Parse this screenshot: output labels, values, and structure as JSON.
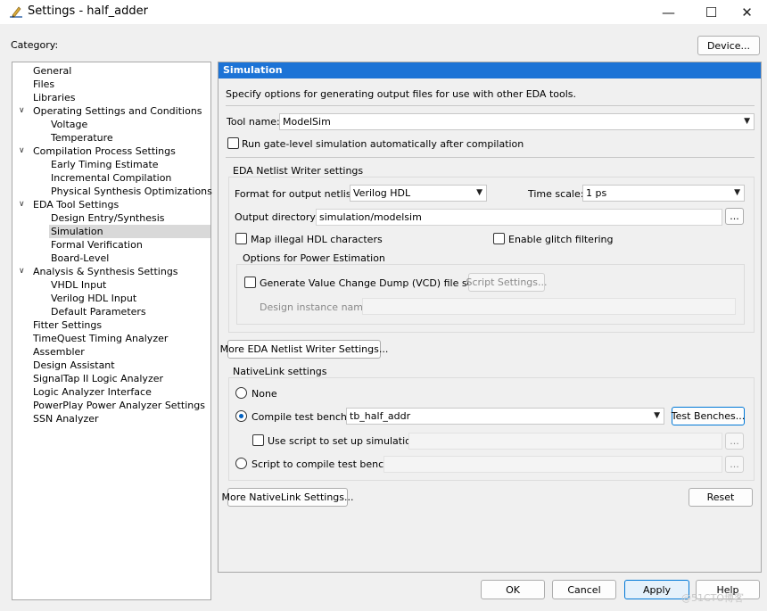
{
  "window": {
    "title": "Settings - half_adder",
    "minimize_glyph": "—",
    "maximize_glyph": "☐",
    "close_glyph": "✕",
    "icon": "pencil-icon"
  },
  "category_label": "Category:",
  "device_button": "Device...",
  "tree": [
    {
      "label": "General",
      "level": 0
    },
    {
      "label": "Files",
      "level": 0
    },
    {
      "label": "Libraries",
      "level": 0
    },
    {
      "label": "Operating Settings and Conditions",
      "level": 0,
      "expanded": true
    },
    {
      "label": "Voltage",
      "level": 1
    },
    {
      "label": "Temperature",
      "level": 1
    },
    {
      "label": "Compilation Process Settings",
      "level": 0,
      "expanded": true
    },
    {
      "label": "Early Timing Estimate",
      "level": 1
    },
    {
      "label": "Incremental Compilation",
      "level": 1
    },
    {
      "label": "Physical Synthesis Optimizations",
      "level": 1
    },
    {
      "label": "EDA Tool Settings",
      "level": 0,
      "expanded": true
    },
    {
      "label": "Design Entry/Synthesis",
      "level": 1
    },
    {
      "label": "Simulation",
      "level": 1,
      "selected": true
    },
    {
      "label": "Formal Verification",
      "level": 1
    },
    {
      "label": "Board-Level",
      "level": 1
    },
    {
      "label": "Analysis & Synthesis Settings",
      "level": 0,
      "expanded": true
    },
    {
      "label": "VHDL Input",
      "level": 1
    },
    {
      "label": "Verilog HDL Input",
      "level": 1
    },
    {
      "label": "Default Parameters",
      "level": 1
    },
    {
      "label": "Fitter Settings",
      "level": 0
    },
    {
      "label": "TimeQuest Timing Analyzer",
      "level": 0
    },
    {
      "label": "Assembler",
      "level": 0
    },
    {
      "label": "Design Assistant",
      "level": 0
    },
    {
      "label": "SignalTap II Logic Analyzer",
      "level": 0
    },
    {
      "label": "Logic Analyzer Interface",
      "level": 0
    },
    {
      "label": "PowerPlay Power Analyzer Settings",
      "level": 0
    },
    {
      "label": "SSN Analyzer",
      "level": 0
    }
  ],
  "sim": {
    "header": "Simulation",
    "description": "Specify options for generating output files for use with other EDA tools.",
    "tool_name_label": "Tool name:",
    "tool_name_value": "ModelSim",
    "run_gate_level": "Run gate-level simulation automatically after compilation",
    "netlist_group": "EDA Netlist Writer settings",
    "format_label": "Format for output netlist:",
    "format_value": "Verilog HDL",
    "timescale_label": "Time scale:",
    "timescale_value": "1 ps",
    "output_dir_label": "Output directory:",
    "output_dir_value": "simulation/modelsim",
    "browse": "...",
    "map_illegal": "Map illegal HDL characters",
    "enable_glitch": "Enable glitch filtering",
    "power_group": "Options for Power Estimation",
    "generate_vcd": "Generate Value Change Dump (VCD) file script",
    "script_settings": "Script Settings...",
    "design_instance_label": "Design instance name:",
    "more_eda": "More EDA Netlist Writer Settings...",
    "nativelink_group": "NativeLink settings",
    "none": "None",
    "compile_tb_label": "Compile test bench:",
    "compile_tb_value": "tb_half_addr",
    "test_benches": "Test Benches...",
    "use_script": "Use script to set up simulation:",
    "script_compile": "Script to compile test bench:",
    "more_nativelink": "More NativeLink Settings...",
    "reset": "Reset"
  },
  "footer": {
    "ok": "OK",
    "cancel": "Cancel",
    "apply": "Apply",
    "help": "Help"
  },
  "watermark": "@51CTO博客"
}
